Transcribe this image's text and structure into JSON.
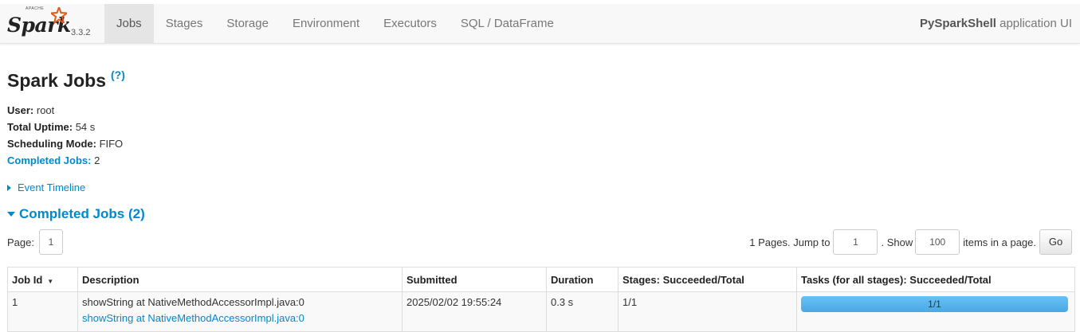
{
  "brand": {
    "apache": "APACHE",
    "spark": "Spark",
    "version": "3.3.2",
    "star_color": "#e25a1c"
  },
  "nav": {
    "tabs": [
      {
        "label": "Jobs",
        "active": true
      },
      {
        "label": "Stages"
      },
      {
        "label": "Storage"
      },
      {
        "label": "Environment"
      },
      {
        "label": "Executors"
      },
      {
        "label": "SQL / DataFrame"
      }
    ],
    "app_name": "PySparkShell",
    "app_suffix": " application UI"
  },
  "page": {
    "title": "Spark Jobs",
    "help": "(?)"
  },
  "summary": {
    "user_label": "User:",
    "user_value": " root",
    "uptime_label": "Total Uptime:",
    "uptime_value": " 54 s",
    "mode_label": "Scheduling Mode:",
    "mode_value": " FIFO",
    "completed_label": "Completed Jobs:",
    "completed_value": " 2"
  },
  "event_timeline": "Event Timeline",
  "completed_section": "Completed Jobs (2)",
  "pager": {
    "page_label": "Page:",
    "page_value": "1",
    "pages_text": "1 Pages. Jump to",
    "jump_value": "1",
    "show_text": ". Show",
    "show_value": "100",
    "items_text": "items in a page.",
    "go_label": "Go"
  },
  "table": {
    "headers": [
      "Job Id",
      "Description",
      "Submitted",
      "Duration",
      "Stages: Succeeded/Total",
      "Tasks (for all stages): Succeeded/Total"
    ],
    "sort_arrow": "▼",
    "rows": [
      {
        "job_id": "1",
        "description": "showString at NativeMethodAccessorImpl.java:0",
        "description_link": "showString at NativeMethodAccessorImpl.java:0",
        "submitted": "2025/02/02 19:55:24",
        "duration": "0.3 s",
        "stages": "1/1",
        "tasks": "1/1",
        "tasks_progress": 1.0
      }
    ]
  },
  "colors": {
    "link": "#0088cc",
    "progress": "#5bb8ee"
  }
}
